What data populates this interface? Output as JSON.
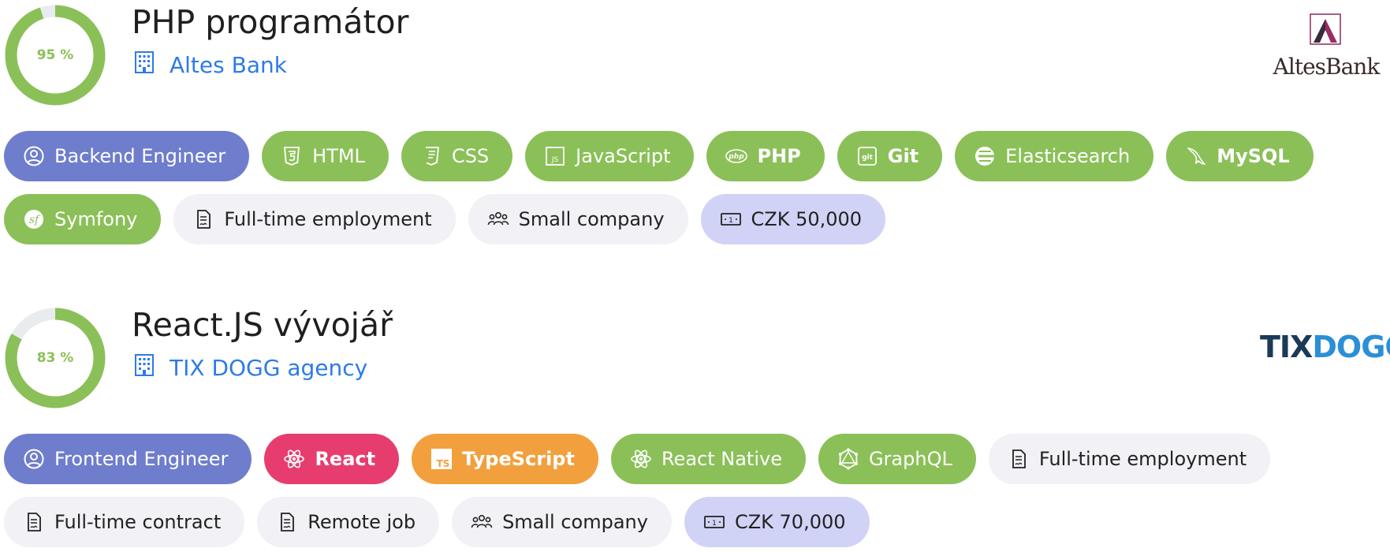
{
  "jobs": [
    {
      "match": "95 %",
      "match_value": 95,
      "title": "PHP programátor",
      "company": "Altes Bank",
      "logo_text": "AltesBank",
      "tags": [
        {
          "label": "Backend Engineer",
          "style": "role",
          "icon": "user-circle-icon",
          "bold": false
        },
        {
          "label": "HTML",
          "style": "green",
          "icon": "html5-icon",
          "bold": false
        },
        {
          "label": "CSS",
          "style": "green",
          "icon": "css3-icon",
          "bold": false
        },
        {
          "label": "JavaScript",
          "style": "green",
          "icon": "js-icon",
          "bold": false
        },
        {
          "label": "PHP",
          "style": "green",
          "icon": "php-icon",
          "bold": true
        },
        {
          "label": "Git",
          "style": "green",
          "icon": "git-icon",
          "bold": true
        },
        {
          "label": "Elasticsearch",
          "style": "green",
          "icon": "elasticsearch-icon",
          "bold": false
        },
        {
          "label": "MySQL",
          "style": "green",
          "icon": "mysql-dolphin-icon",
          "bold": true
        },
        {
          "label": "Symfony",
          "style": "green",
          "icon": "symfony-icon",
          "bold": false
        },
        {
          "label": "Full-time employment",
          "style": "gray",
          "icon": "contract-icon",
          "bold": false
        },
        {
          "label": "Small company",
          "style": "gray",
          "icon": "people-group-icon",
          "bold": false
        },
        {
          "label": "CZK 50,000",
          "style": "salary",
          "icon": "banknote-icon",
          "bold": false
        }
      ]
    },
    {
      "match": "83 %",
      "match_value": 83,
      "title": "React.JS vývojář",
      "company": "TIX DOGG agency",
      "logo_text": "TIXDOGG",
      "tags": [
        {
          "label": "Frontend Engineer",
          "style": "role",
          "icon": "user-circle-icon",
          "bold": false
        },
        {
          "label": "React",
          "style": "red",
          "icon": "react-icon",
          "bold": true
        },
        {
          "label": "TypeScript",
          "style": "orange",
          "icon": "typescript-icon",
          "bold": true
        },
        {
          "label": "React Native",
          "style": "green",
          "icon": "react-icon",
          "bold": false
        },
        {
          "label": "GraphQL",
          "style": "green",
          "icon": "graphql-icon",
          "bold": false
        },
        {
          "label": "Full-time employment",
          "style": "gray",
          "icon": "contract-icon",
          "bold": false
        },
        {
          "label": "Full-time contract",
          "style": "gray",
          "icon": "contract-icon",
          "bold": false
        },
        {
          "label": "Remote job",
          "style": "gray",
          "icon": "contract-icon",
          "bold": false
        },
        {
          "label": "Small company",
          "style": "gray",
          "icon": "people-group-icon",
          "bold": false
        },
        {
          "label": "CZK 70,000",
          "style": "salary",
          "icon": "banknote-icon",
          "bold": false
        }
      ]
    }
  ],
  "colors": {
    "match_green": "#8bc058",
    "ring_track": "#e8ecee",
    "link_blue": "#2d7be5",
    "role_purple": "#6f7dcd",
    "react_red": "#e73d6e",
    "typescript_orange": "#f2a03d",
    "neutral_gray": "#f1f1f6",
    "salary_lavender": "#d1d3f6"
  }
}
